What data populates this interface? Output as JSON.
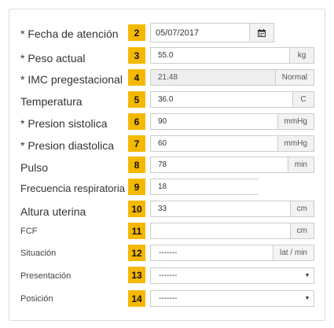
{
  "form": {
    "rows": [
      {
        "label": "* Fecha de atención",
        "badge": "2",
        "value": "05/07/2017",
        "icon": "calendar-icon"
      },
      {
        "label": "* Peso actual",
        "badge": "3",
        "value": "55.0",
        "unit": "kg"
      },
      {
        "label": "* IMC pregestacional",
        "badge": "4",
        "value": "21.48",
        "unit": "Normal"
      },
      {
        "label": "Temperatura",
        "badge": "5",
        "value": "36.0",
        "unit": "C"
      },
      {
        "label": "* Presion sistolica",
        "badge": "6",
        "value": "90",
        "unit": "mmHg"
      },
      {
        "label": "* Presion diastolica",
        "badge": "7",
        "value": "60",
        "unit": "mmHg"
      },
      {
        "label": "Pulso",
        "badge": "8",
        "value": "78",
        "unit": "min"
      },
      {
        "label": "Frecuencia respiratoria",
        "badge": "9",
        "value": "18"
      },
      {
        "label": "Altura uterina",
        "badge": "10",
        "value": "33",
        "unit": "cm"
      },
      {
        "label": "FCF",
        "badge": "11",
        "value": "",
        "unit": "cm"
      },
      {
        "label": "Situación",
        "badge": "12",
        "value": "-------",
        "unit": "lat / min"
      },
      {
        "label": "Presentación",
        "badge": "13",
        "value": "-------"
      },
      {
        "label": "Posición",
        "badge": "14",
        "value": "-------"
      }
    ]
  }
}
